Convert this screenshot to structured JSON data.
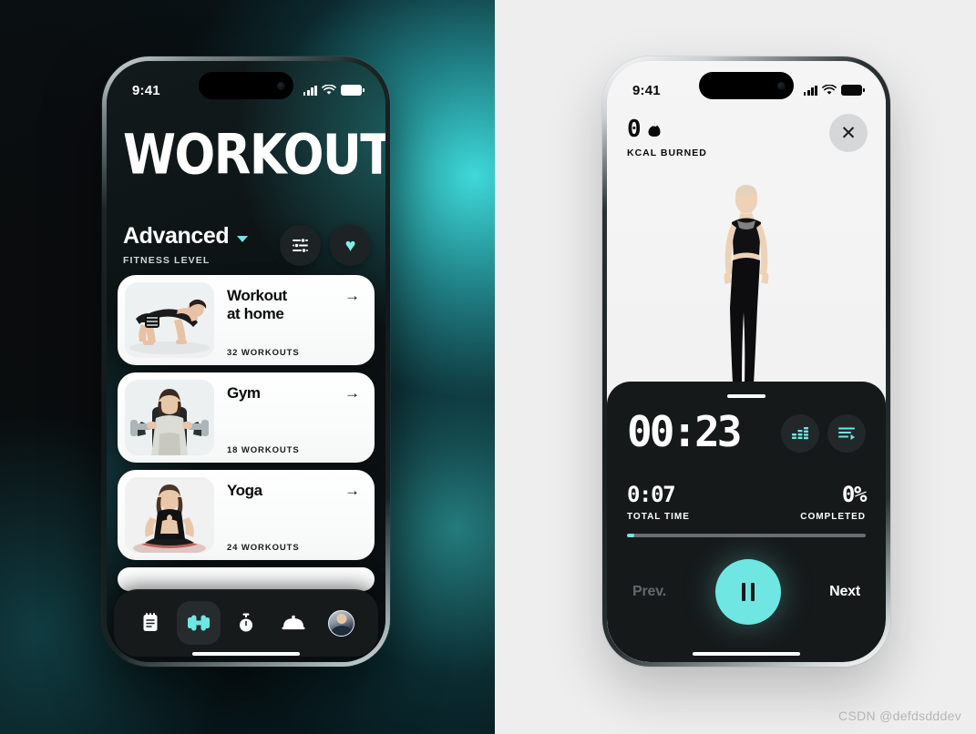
{
  "watermark": "CSDN @defdsdddev",
  "colors": {
    "accent_teal": "#6fe6e2",
    "dark_surface": "#16191a",
    "card_white": "#ffffff",
    "right_bg": "#eeeeee"
  },
  "left_phone": {
    "status_bar": {
      "time": "9:41",
      "cellular_icon": "signal-bars-icon",
      "wifi_icon": "wifi-icon",
      "battery_icon": "battery-full-icon"
    },
    "page_title": "WORKOUT",
    "fitness_level": {
      "value": "Advanced",
      "label": "FITNESS LEVEL",
      "chevron_icon": "chevron-down-icon"
    },
    "actions": [
      {
        "name": "filter-button",
        "icon": "sliders-icon"
      },
      {
        "name": "favorites-button",
        "icon": "heart-icon",
        "glyph": "♥"
      }
    ],
    "cards": [
      {
        "title": "Workout\nat home",
        "title_line1": "Workout",
        "title_line2": "at home",
        "count": "32 WORKOUTS",
        "arrow": "→",
        "thumb": "plank-exercise-photo"
      },
      {
        "title": "Gym",
        "title_line1": "Gym",
        "title_line2": "",
        "count": "18 WORKOUTS",
        "arrow": "→",
        "thumb": "chest-press-machine-photo"
      },
      {
        "title": "Yoga",
        "title_line1": "Yoga",
        "title_line2": "",
        "count": "24 WORKOUTS",
        "arrow": "→",
        "thumb": "yoga-meditation-photo"
      }
    ],
    "tabs": [
      {
        "name": "tab-plan",
        "icon": "notebook-icon",
        "active": false
      },
      {
        "name": "tab-workout",
        "icon": "dumbbell-icon",
        "active": true
      },
      {
        "name": "tab-timer",
        "icon": "stopwatch-icon",
        "active": false
      },
      {
        "name": "tab-nutrition",
        "icon": "food-cloche-icon",
        "active": false
      },
      {
        "name": "tab-profile",
        "icon": "avatar-icon",
        "active": false
      }
    ]
  },
  "right_phone": {
    "status_bar": {
      "time": "9:41",
      "cellular_icon": "signal-bars-icon",
      "wifi_icon": "wifi-icon",
      "battery_icon": "battery-full-icon"
    },
    "kcal": {
      "value": "0",
      "flame_icon": "flame-icon",
      "label": "KCAL BURNED"
    },
    "close_icon": "close-icon",
    "close_glyph": "✕",
    "exercise_media": "standing-woman-on-mat-photo",
    "sheet": {
      "grabber": "drag-handle",
      "timer": "00:23",
      "round_buttons": [
        {
          "name": "stats-button",
          "icon": "equalizer-icon"
        },
        {
          "name": "playlist-button",
          "icon": "list-play-icon"
        }
      ],
      "total_time": {
        "value": "0:07",
        "label": "TOTAL TIME"
      },
      "completed": {
        "value": "0%",
        "label": "COMPLETED"
      },
      "progress_percent": 3,
      "controls": {
        "prev_label": "Prev.",
        "next_label": "Next",
        "play_pause_icon": "pause-icon"
      }
    }
  }
}
